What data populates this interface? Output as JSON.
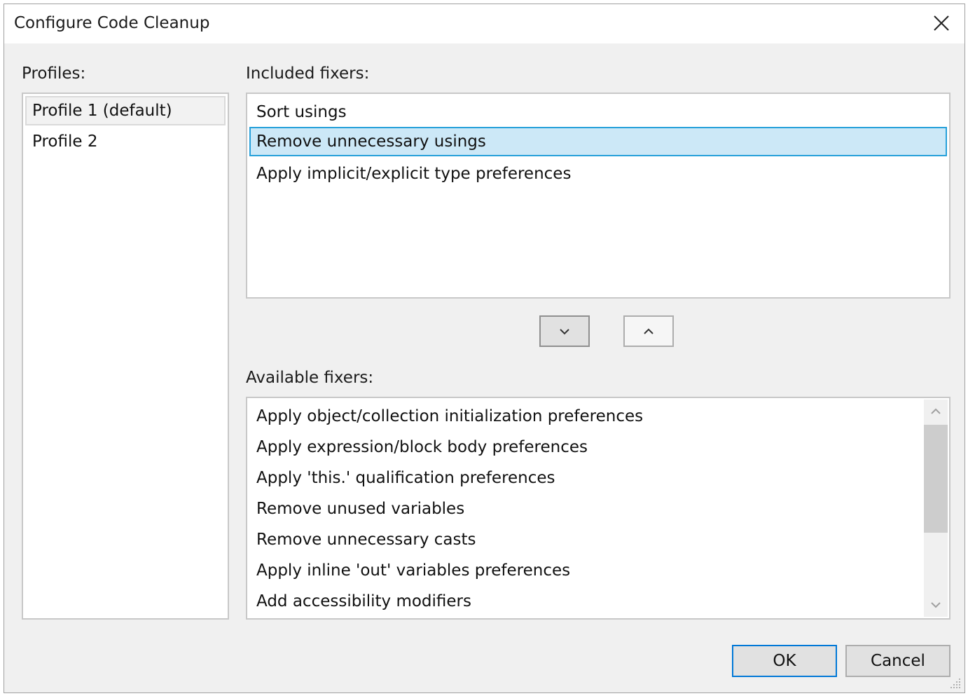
{
  "window": {
    "title": "Configure Code Cleanup"
  },
  "profiles": {
    "label": "Profiles:",
    "items": [
      {
        "label": "Profile 1 (default)"
      },
      {
        "label": "Profile 2"
      }
    ],
    "selected": "Profile 1 (default)"
  },
  "included": {
    "label": "Included fixers:",
    "items": [
      {
        "label": "Sort usings"
      },
      {
        "label": "Remove unnecessary usings"
      },
      {
        "label": "Apply implicit/explicit type preferences"
      }
    ],
    "selected": "Remove unnecessary usings"
  },
  "move_buttons": {
    "down_icon": "chevron-down-icon",
    "up_icon": "chevron-up-icon"
  },
  "available": {
    "label": "Available fixers:",
    "items": [
      {
        "label": "Apply object/collection initialization preferences"
      },
      {
        "label": "Apply expression/block body preferences"
      },
      {
        "label": "Apply 'this.' qualification preferences"
      },
      {
        "label": "Remove unused variables"
      },
      {
        "label": "Remove unnecessary casts"
      },
      {
        "label": "Apply inline 'out' variables preferences"
      },
      {
        "label": "Add accessibility modifiers"
      }
    ]
  },
  "footer": {
    "ok_label": "OK",
    "cancel_label": "Cancel"
  },
  "colors": {
    "dialog_bg": "#f0f0f0",
    "selection_bg": "#cce8f7",
    "selection_border": "#26a0da",
    "default_button_border": "#0078d7"
  }
}
